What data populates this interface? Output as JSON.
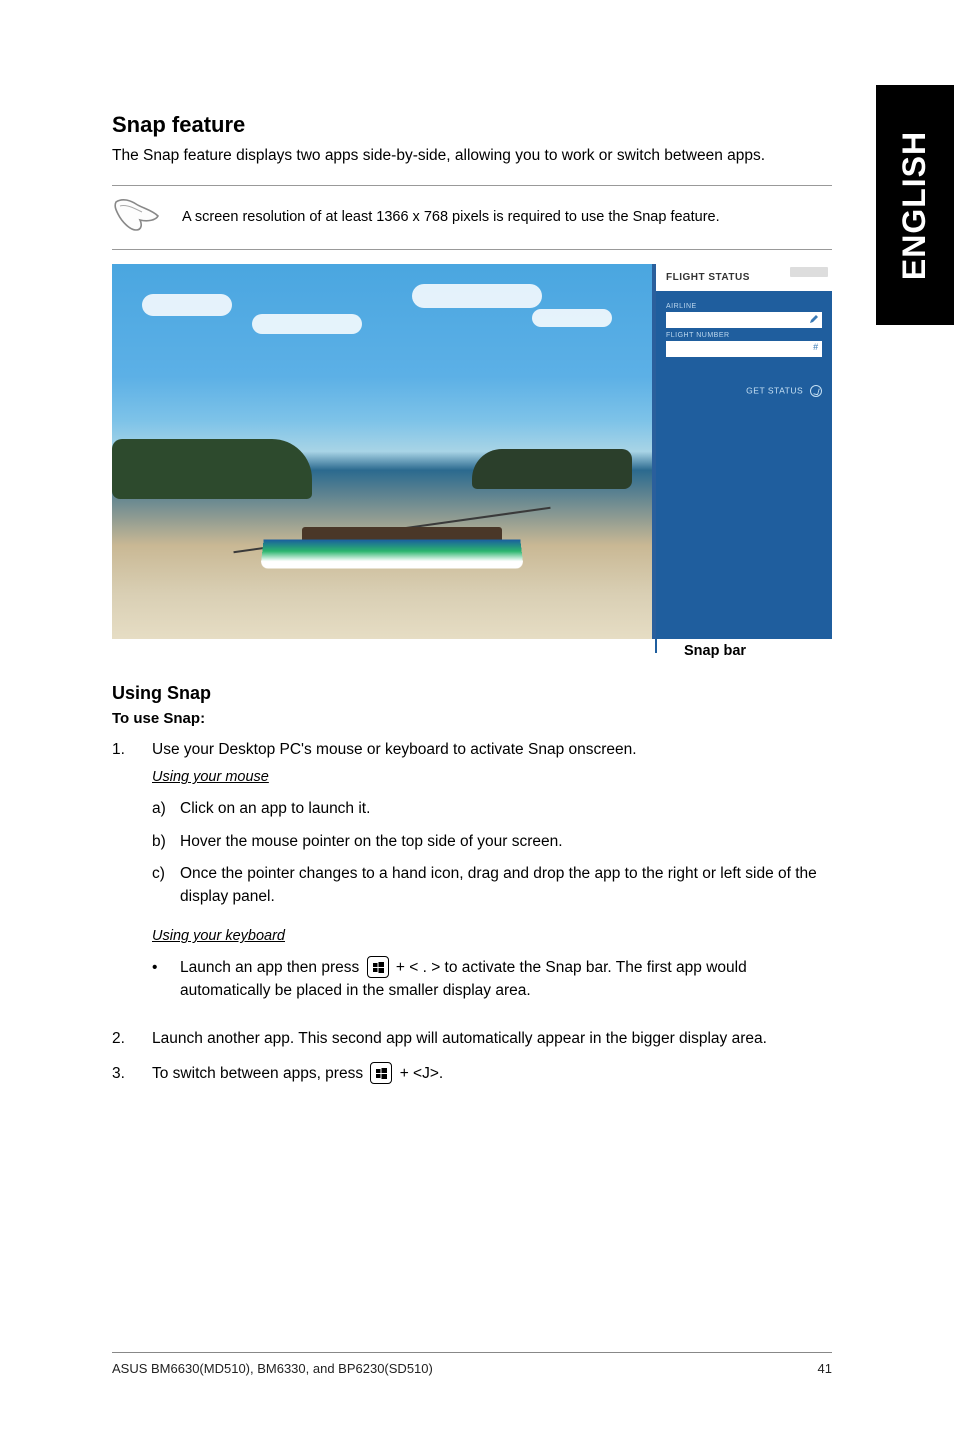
{
  "side_tab": "ENGLISH",
  "heading": "Snap feature",
  "intro": "The Snap feature displays two apps side-by-side, allowing you to work or switch between apps.",
  "note": "A screen resolution of at least 1366 x 768 pixels is required to use the Snap feature.",
  "flight_status": {
    "title": "FLIGHT STATUS",
    "label_airline": "AIRLINE",
    "label_flight_number": "FLIGHT NUMBER",
    "get_status": "GET STATUS"
  },
  "snap_bar_label": "Snap bar",
  "using_snap_heading": "Using Snap",
  "to_use_snap": "To use Snap:",
  "step1": "Use your Desktop PC's mouse or keyboard to activate Snap onscreen.",
  "mouse": {
    "heading": "Using your mouse",
    "a": "Click on an app to launch it.",
    "b": "Hover the mouse pointer on the top side of your screen.",
    "c": "Once the pointer changes to a hand icon, drag and drop the app to the right or left side of the display panel."
  },
  "keyboard": {
    "heading": "Using your keyboard",
    "bullet_pre": "Launch an app then press ",
    "bullet_mid": " + < . > to activate the Snap bar. The first app would automatically be placed in the smaller display area."
  },
  "step2": "Launch another app. This second app will automatically appear in the bigger display area.",
  "step3_pre": "To switch between apps, press ",
  "step3_post": " + <J>.",
  "footer_left": "ASUS BM6630(MD510), BM6330, and BP6230(SD510)",
  "footer_right": "41"
}
